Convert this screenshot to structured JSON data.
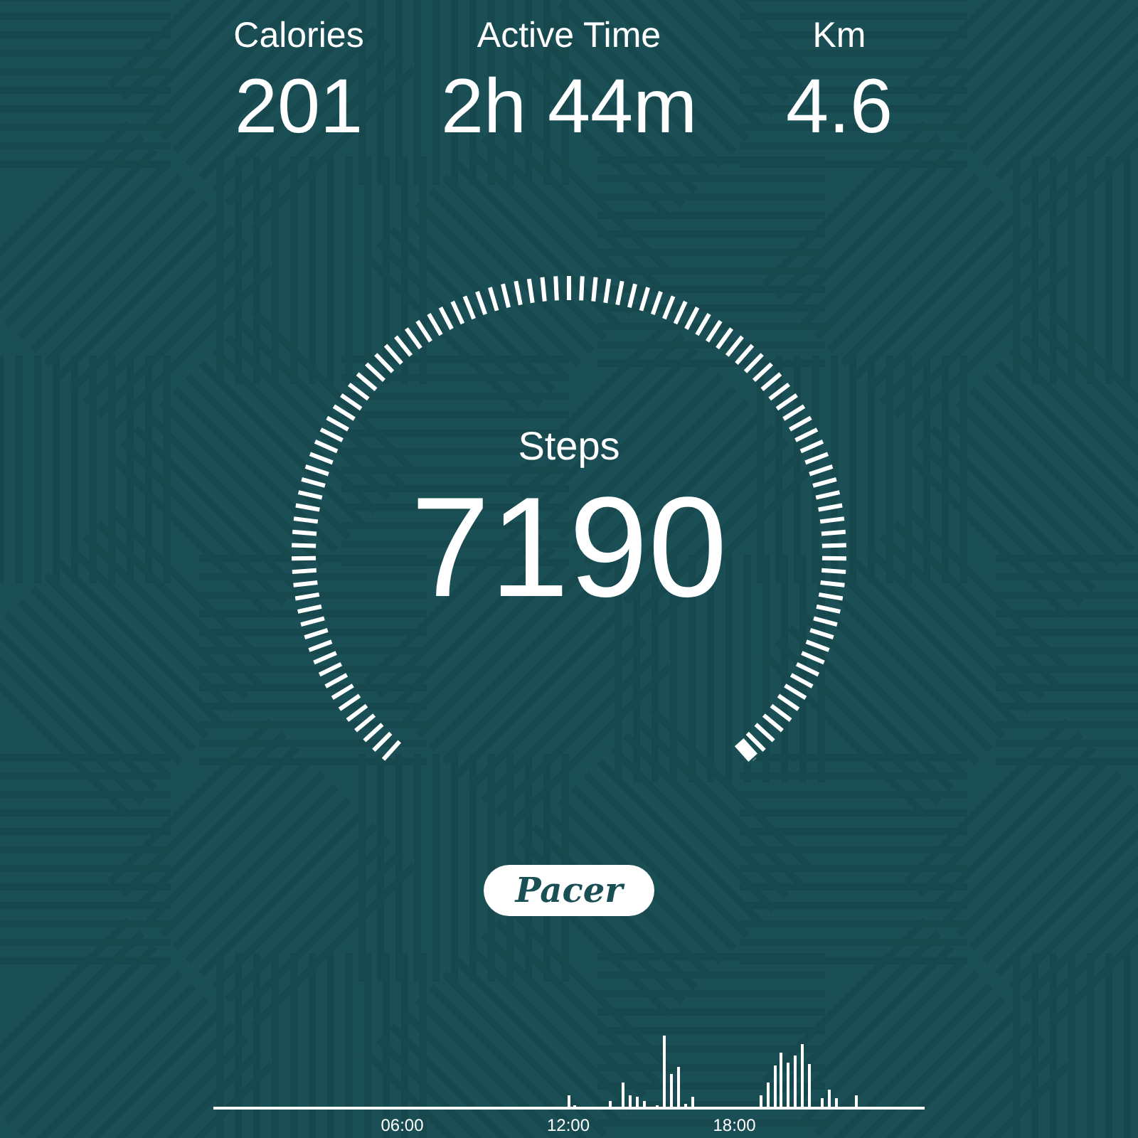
{
  "stats": [
    {
      "label": "Calories",
      "value": "201"
    },
    {
      "label": "Active Time",
      "value": "2h 44m"
    },
    {
      "label": "Km",
      "value": "4.6"
    }
  ],
  "steps": {
    "label": "Steps",
    "value": "7190"
  },
  "brand": "Pacer",
  "activity_chart": {
    "xticks": [
      "06:00",
      "12:00",
      "18:00"
    ]
  }
}
